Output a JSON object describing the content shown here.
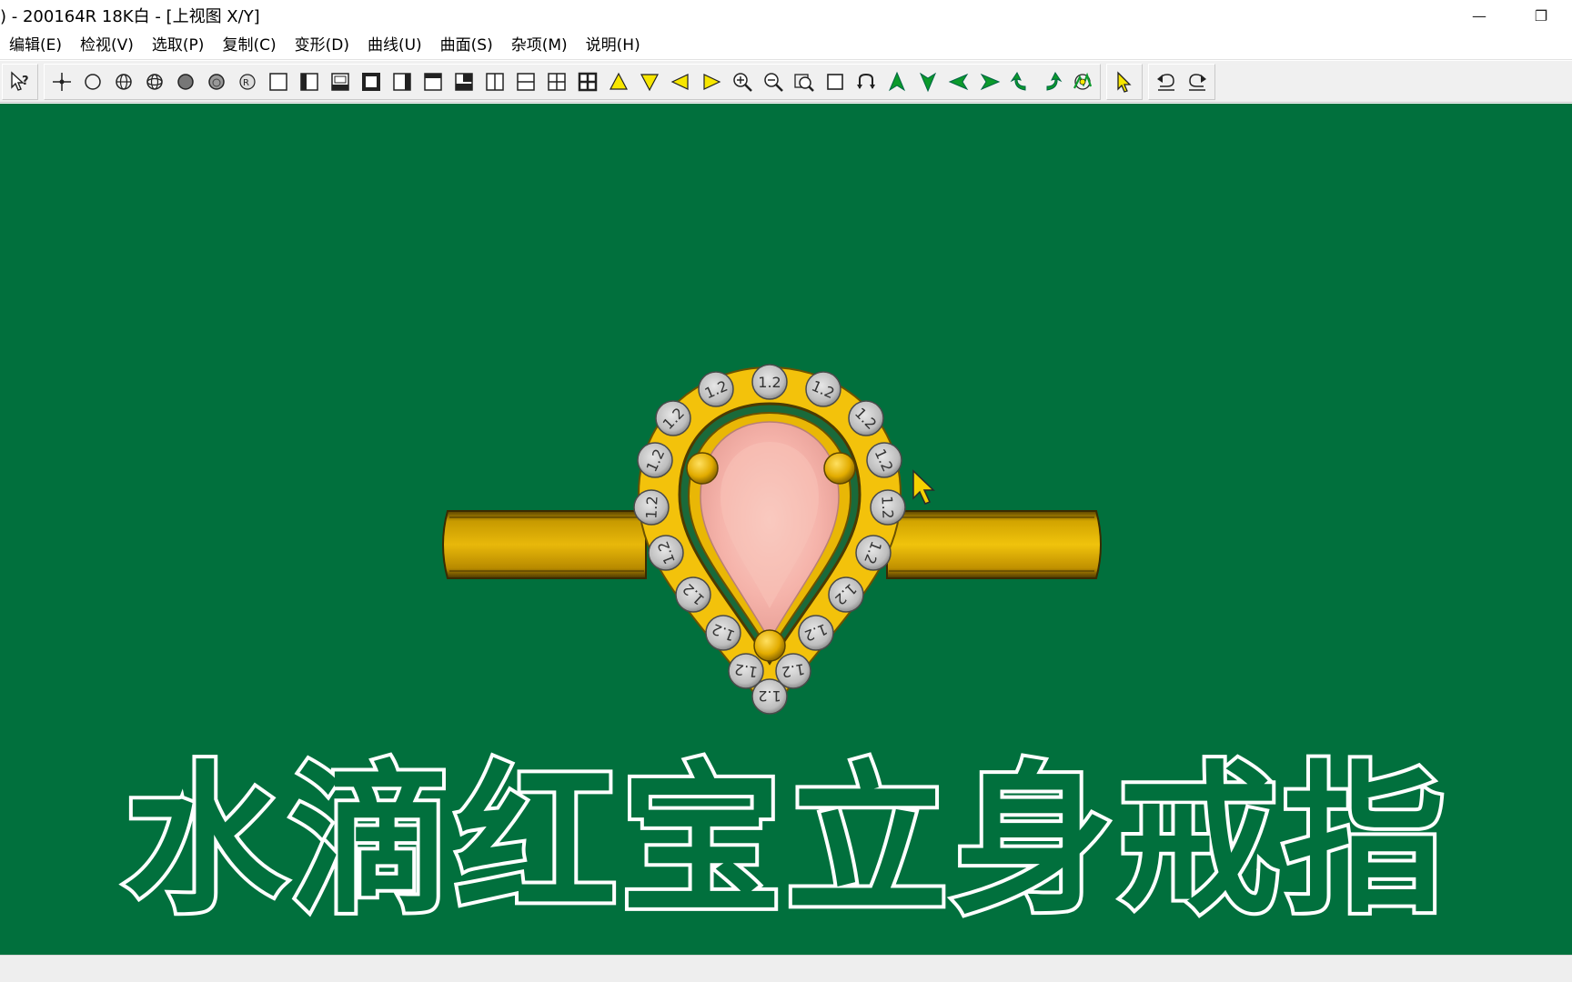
{
  "window": {
    "title": ") - 200164R 18K白 - [上视图 X/Y]",
    "minimize_glyph": "—",
    "restore_glyph": "❐"
  },
  "menu": [
    {
      "label": "编辑(E)"
    },
    {
      "label": "检视(V)"
    },
    {
      "label": "选取(P)"
    },
    {
      "label": "复制(C)"
    },
    {
      "label": "变形(D)"
    },
    {
      "label": "曲线(U)"
    },
    {
      "label": "曲面(S)"
    },
    {
      "label": "杂项(M)"
    },
    {
      "label": "说明(H)"
    }
  ],
  "toolbar": {
    "icons": [
      "help-arrow-icon",
      "point-icon",
      "circle-icon",
      "sphere-wire-icon",
      "sphere-grid-icon",
      "sphere-solid-icon",
      "sphere-shaded-icon",
      "sphere-render-icon",
      "single-view-icon",
      "view-left-panel-icon",
      "view-bottom-panel-icon",
      "view-bold-frame-icon",
      "view-right-panel-icon",
      "view-top-bar-icon",
      "view-bottom-bar-icon",
      "split-vertical-icon",
      "split-horizontal-icon",
      "split-four-icon",
      "split-four-bold-icon",
      "arrow-up-icon",
      "arrow-down-icon",
      "arrow-left-icon",
      "arrow-right-icon",
      "zoom-in-icon",
      "zoom-out-icon",
      "zoom-window-icon",
      "zoom-box-icon",
      "pan-icon",
      "rotate-up-icon",
      "rotate-down-icon",
      "rotate-left-icon",
      "rotate-right-icon",
      "rotate-ccw-icon",
      "rotate-cw-icon",
      "view-reset-icon",
      "select-pointer-icon",
      "undo-icon",
      "redo-icon"
    ]
  },
  "viewport": {
    "background": "#01703d",
    "caption": "水滴红宝立身戒指",
    "stone_label": "1.2",
    "colors": {
      "gold": "#f2c40a",
      "gold_dark": "#8a6a00",
      "ruby": "#f2b0a8",
      "diamond": "#c8c8c8"
    }
  }
}
